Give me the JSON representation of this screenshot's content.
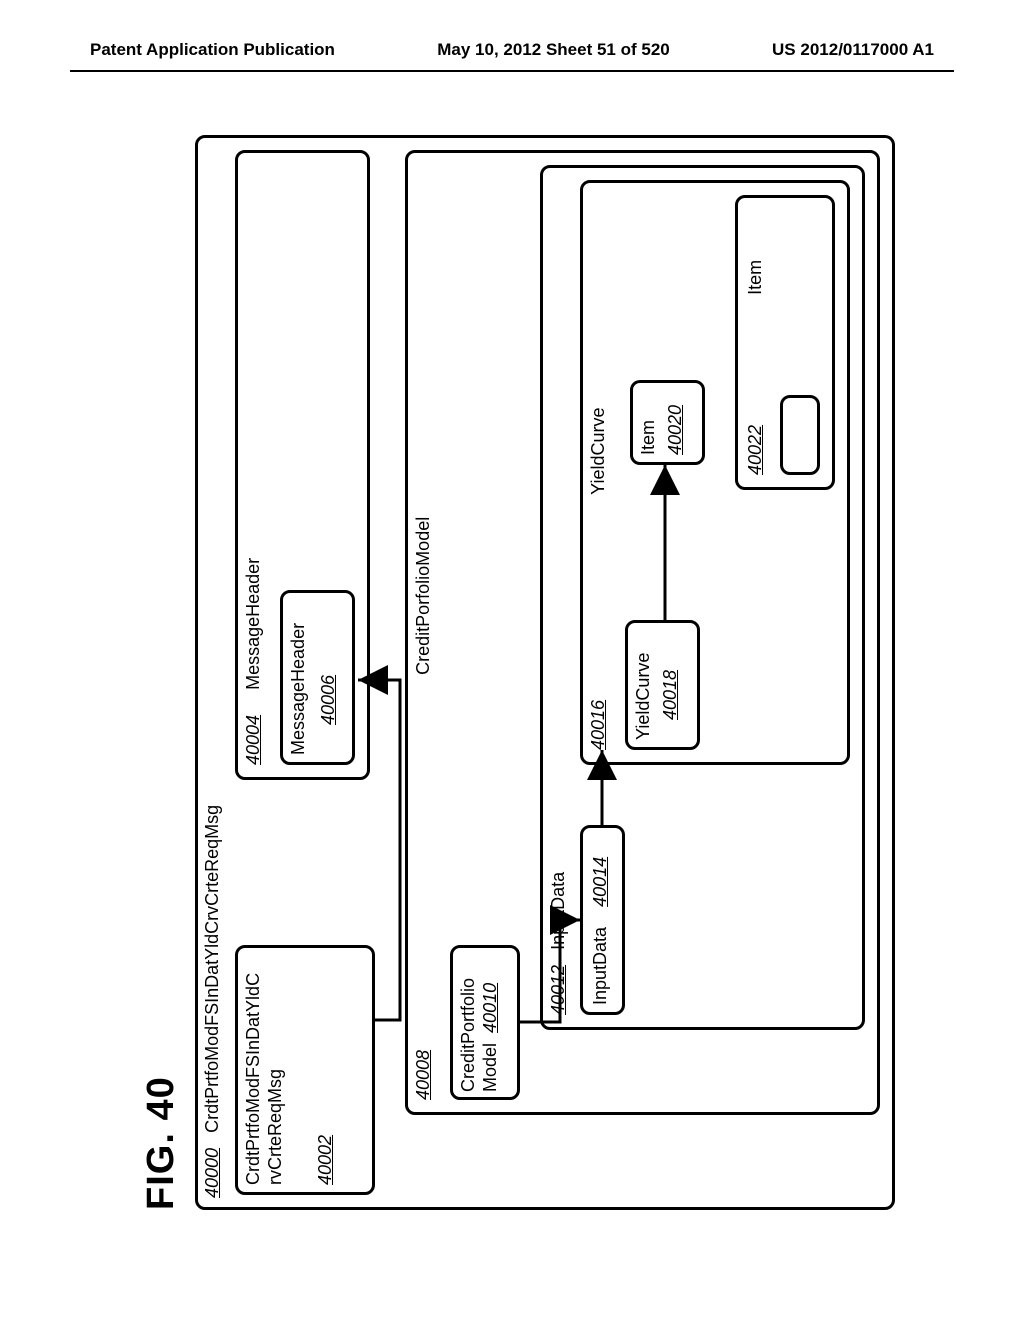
{
  "header": {
    "left": "Patent Application Publication",
    "center": "May 10, 2012  Sheet 51 of 520",
    "right": "US 2012/0117000 A1"
  },
  "figure": {
    "title": "FIG. 40",
    "outer": {
      "id": "40000",
      "name": "CrdtPrtfoModFSInDatYldCrvCrteReqMsg"
    },
    "root_box": {
      "id": "40002",
      "name1": "CrdtPrtfoModFSInDatYldC",
      "name2": "rvCrteReqMsg"
    },
    "msg_header_group": {
      "id": "40004",
      "name": "MessageHeader"
    },
    "msg_header": {
      "id": "40006",
      "name": "MessageHeader"
    },
    "credit_portfolio_group": {
      "id": "40008",
      "name": "CreditPorfolioModel"
    },
    "credit_portfolio": {
      "id": "40010",
      "name1": "CreditPortfolio",
      "name2": "Model"
    },
    "input_data_group": {
      "id": "40012",
      "name": "InputData"
    },
    "input_data": {
      "id": "40014",
      "name": "InputData"
    },
    "yield_curve_group": {
      "id": "40016",
      "name": "YieldCurve"
    },
    "yield_curve": {
      "id": "40018",
      "name": "YieldCurve"
    },
    "item1": {
      "id": "40020",
      "name": "Item"
    },
    "item2": {
      "id": "40022",
      "name": "Item"
    }
  }
}
